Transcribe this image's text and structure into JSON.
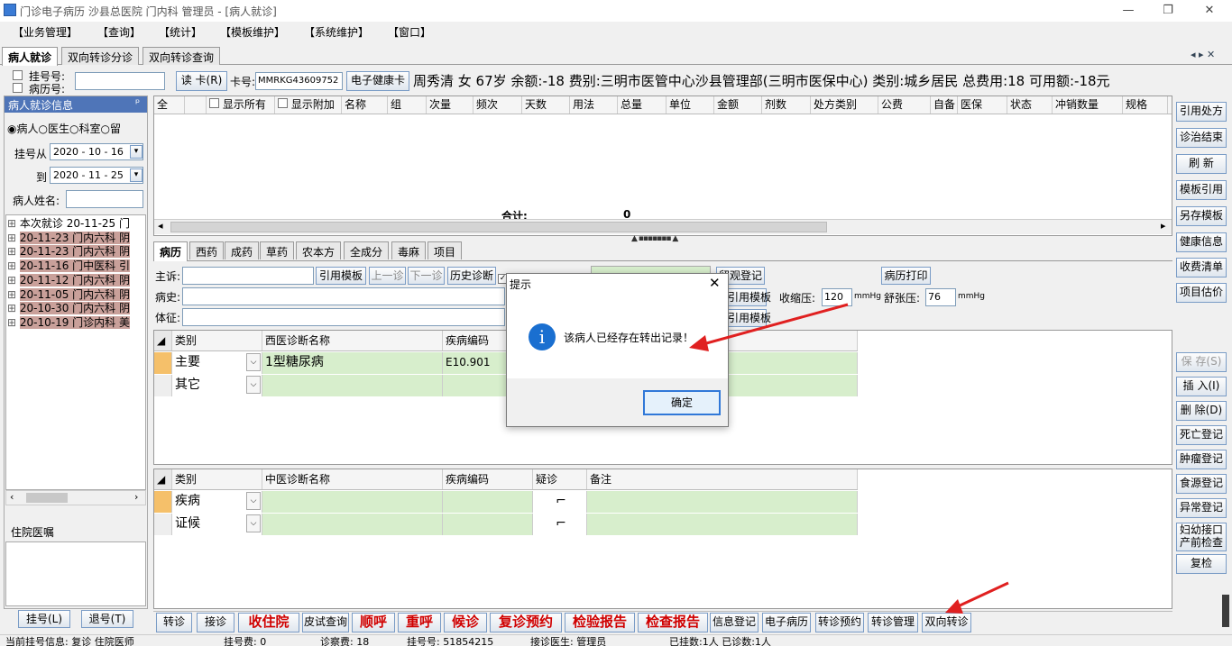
{
  "window": {
    "title": "门诊电子病历  沙县总医院  门内科  管理员 - [病人就诊]",
    "min": "—",
    "restore": "❐",
    "close": "✕"
  },
  "menu": [
    "【业务管理】",
    "【查询】",
    "【统计】",
    "【模板维护】",
    "【系统维护】",
    "【窗口】"
  ],
  "tabs": [
    "病人就诊",
    "双向转诊分诊",
    "双向转诊查询"
  ],
  "tab_nav": "◂ ▸ ✕",
  "patient_bar": {
    "reg_label": "挂号号:",
    "record_label": "病历号:",
    "read_card": "读 卡(R)",
    "card_label": "卡号:",
    "card_value": "MMRKG43609752",
    "ehc_button": "电子健康卡",
    "info": "周秀清  女  67岁  余额:-18  费别:三明市医管中心沙县管理部(三明市医保中心)  类别:城乡居民  总费用:18  可用额:-18元"
  },
  "left": {
    "title": "病人就诊信息",
    "pin": "ᵖ",
    "radios": [
      "病人",
      "医生",
      "科室",
      "留"
    ],
    "from_label": "挂号从",
    "from_date": "2020 - 10 - 16",
    "to_label": "到",
    "to_date": "2020 - 11 - 25",
    "name_label": "病人姓名:",
    "visits": [
      "本次就诊 20-11-25 门",
      "20-11-23 门内六科 阴",
      "20-11-23 门内六科 阴",
      "20-11-16 门中医科 引",
      "20-11-12 门内六科 阴",
      "20-11-05 门内六科 阴",
      "20-10-30 门内六科 阴",
      "20-10-19 门诊内科 美"
    ],
    "orders_title": "住院医嘱",
    "register_btn": "挂号(L)",
    "cancel_btn": "退号(T)"
  },
  "rx_grid": {
    "headers": [
      "全",
      "显示所有",
      "显示附加",
      "名称",
      "组",
      "次量",
      "频次",
      "天数",
      "用法",
      "总量",
      "单位",
      "金额",
      "剂数",
      "处方类别",
      "公费",
      "自备",
      "医保",
      "状态",
      "冲销数量",
      "规格"
    ],
    "total_label": "合计:",
    "total_value": "0"
  },
  "sub_tabs": [
    "病历",
    "西药",
    "成药",
    "草药",
    "农本方",
    "全成分",
    "毒麻",
    "项目"
  ],
  "record": {
    "chief_label": "主诉:",
    "cite_template": "引用模板",
    "prev": "上一诊",
    "next": "下一诊",
    "history": "历史诊断",
    "present_label": "病史:",
    "exam_label": "体征:",
    "observe_btn": "留观登记",
    "print_btn": "病历打印",
    "cite_template2": "引用模板",
    "cite_template3": "引用模板",
    "sys_label": "收缩压:",
    "sys_value": "120",
    "unit": "mmHg",
    "dia_label": "舒张压:",
    "dia_value": "76"
  },
  "wm_grid": {
    "headers": [
      "类别",
      "西医诊断名称",
      "疾病编码"
    ],
    "rows": [
      {
        "type": "主要",
        "name": "1型糖尿病",
        "code": "E10.901"
      },
      {
        "type": "其它",
        "name": "",
        "code": ""
      }
    ]
  },
  "tcm_grid": {
    "headers": [
      "类别",
      "中医诊断名称",
      "疾病编码",
      "疑诊",
      "备注"
    ],
    "rows": [
      {
        "type": "疾病"
      },
      {
        "type": "证候"
      }
    ]
  },
  "dialog": {
    "title": "提示",
    "message": "该病人已经存在转出记录！",
    "ok": "确定"
  },
  "right_buttons": [
    "引用处方",
    "诊治结束",
    "刷 新",
    "模板引用",
    "另存模板",
    "健康信息",
    "收费清单",
    "项目估价",
    "保 存(S)",
    "插 入(I)",
    "删 除(D)",
    "死亡登记",
    "肿瘤登记",
    "食源登记",
    "异常登记",
    "妇幼接口 产前检查",
    "复检"
  ],
  "bottom_buttons": [
    "转诊",
    "接诊",
    "收住院",
    "皮试查询",
    "顺呼",
    "重呼",
    "候诊",
    "复诊预约",
    "检验报告",
    "检查报告",
    "信息登记",
    "电子病历",
    "转诊预约",
    "转诊管理",
    "双向转诊"
  ],
  "status": {
    "reg_info": "当前挂号信息:  复诊 住院医师",
    "reg_fee": "挂号费:  0",
    "diag_fee": "诊察费:  18",
    "reg_no": "挂号号:  51854215",
    "doctor": "接诊医生:  管理员",
    "counts": "已挂数:1人  已诊数:1人"
  },
  "colors": {
    "accent": "#4f75b8",
    "highlight": "#c9a09a",
    "green": "#d7eecc",
    "red": "#d00000",
    "arrow": "#e02020"
  }
}
